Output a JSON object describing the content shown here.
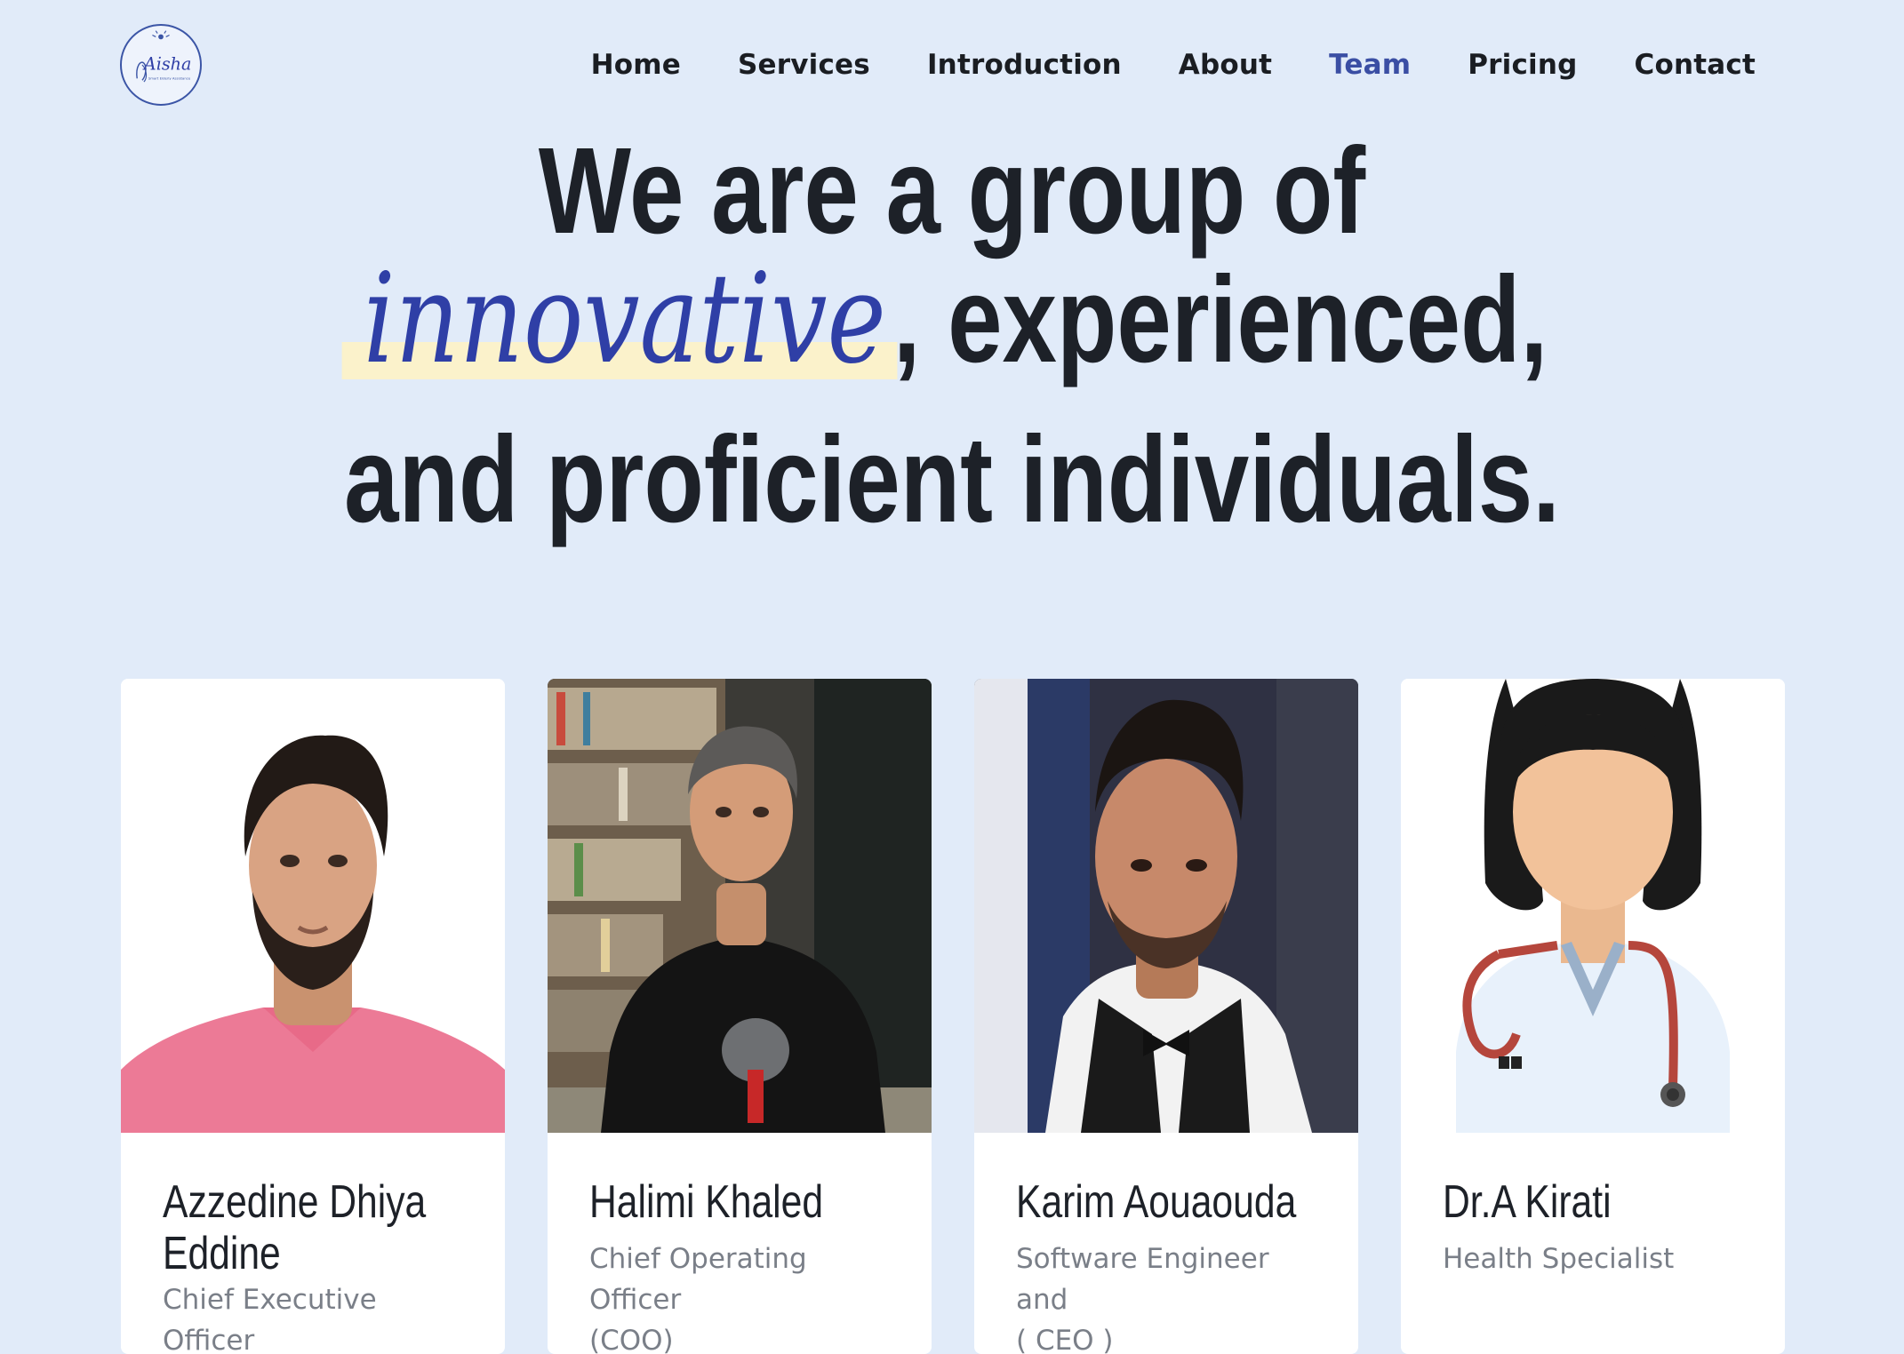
{
  "brand": {
    "logo_text": "Aisha",
    "logo_subtext": "Smart Elderly Assistance"
  },
  "nav": {
    "items": [
      {
        "label": "Home"
      },
      {
        "label": "Services"
      },
      {
        "label": "Introduction"
      },
      {
        "label": "About"
      },
      {
        "label": "Team",
        "active": true
      },
      {
        "label": "Pricing"
      },
      {
        "label": "Contact"
      }
    ]
  },
  "hero": {
    "line1": "We are a group of",
    "highlight": "innovative",
    "line2_rest": ", experienced,",
    "line3": "and proficient individuals."
  },
  "team": [
    {
      "name": "Azzedine Dhiya",
      "name2": "Eddine",
      "role": "Chief Executive Officer"
    },
    {
      "name": "Halimi Khaled",
      "role": "Chief Operating Officer",
      "role2": "(COO)"
    },
    {
      "name": "Karim Aouaouda",
      "role": "Software Engineer and",
      "role2": "( CEO )"
    },
    {
      "name": "Dr.A Kirati",
      "role": "Health Specialist"
    }
  ],
  "colors": {
    "background": "#e1ebf9",
    "accent": "#3a4ea4",
    "highlight": "#fbf2cb",
    "text": "#1d2128",
    "muted": "#7a7f88"
  }
}
